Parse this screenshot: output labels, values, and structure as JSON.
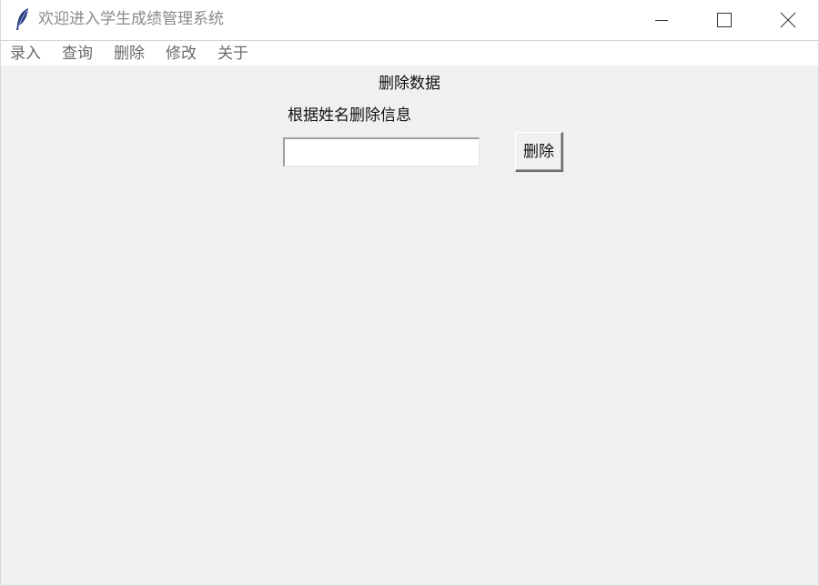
{
  "window": {
    "title": "欢迎进入学生成绩管理系统",
    "app_icon": "feather-icon",
    "controls": {
      "minimize_icon": "minimize-icon",
      "maximize_icon": "maximize-icon",
      "close_icon": "close-icon"
    }
  },
  "menu": {
    "items": [
      {
        "label": "录入"
      },
      {
        "label": "查询"
      },
      {
        "label": "删除"
      },
      {
        "label": "修改"
      },
      {
        "label": "关于"
      }
    ]
  },
  "main": {
    "heading": "删除数据",
    "prompt": "根据姓名删除信息",
    "name_input": {
      "value": "",
      "placeholder": ""
    },
    "delete_button_label": "删除"
  },
  "colors": {
    "background": "#f0f0f0",
    "titlebar": "#ffffff",
    "menu_text": "#6a6a6a",
    "title_text": "#8a8a8a"
  }
}
